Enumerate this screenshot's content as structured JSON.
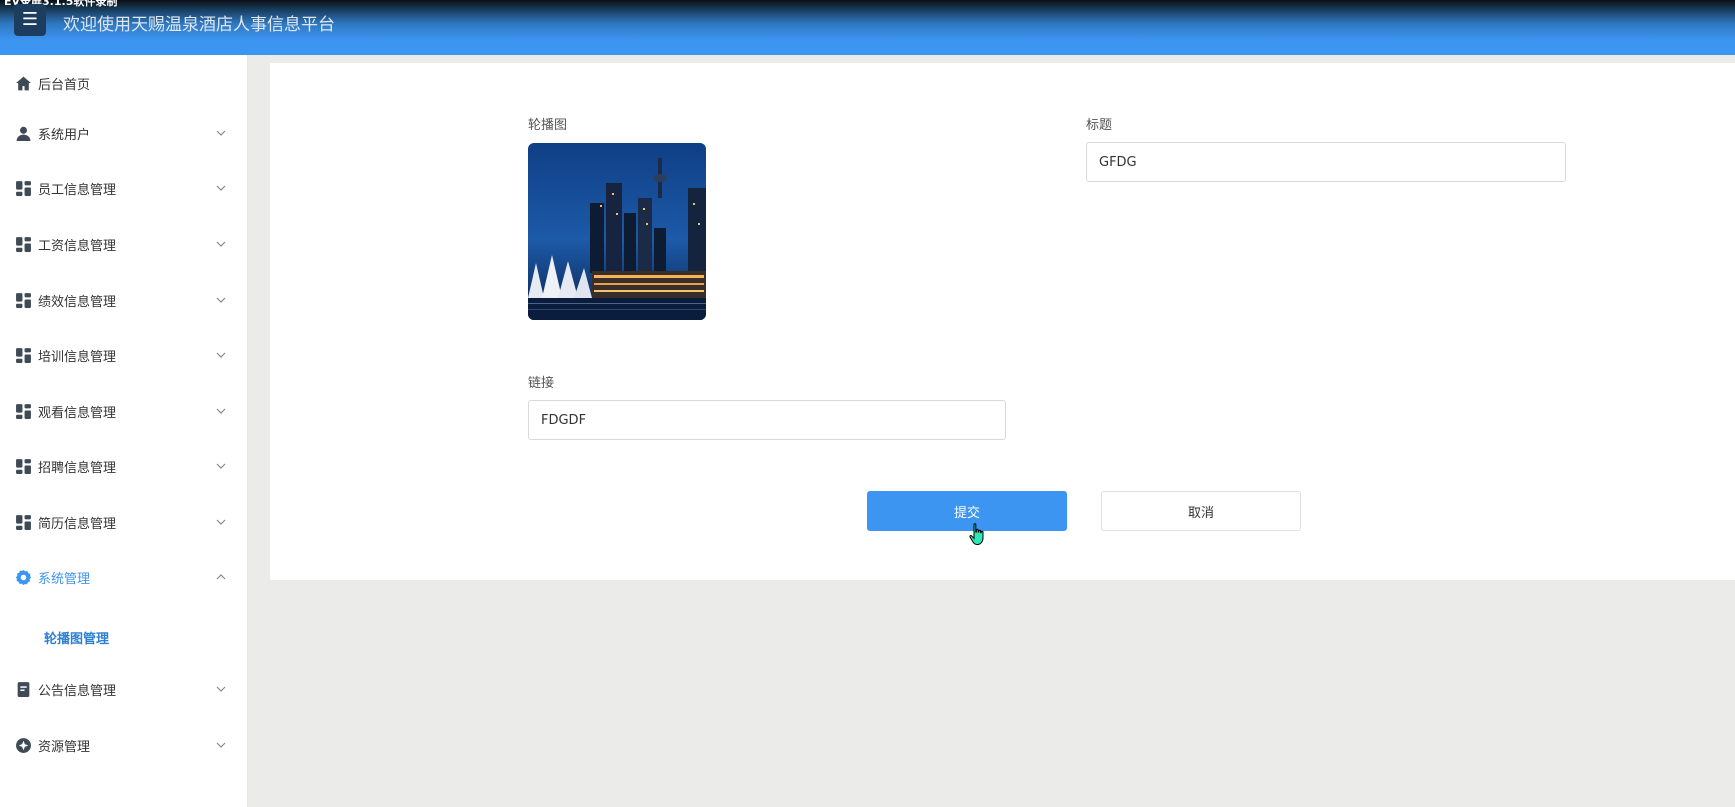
{
  "header": {
    "watermark": "EV录屏3.1.5软件录制",
    "menu_icon": "hamburger-icon",
    "title": "欢迎使用天赐温泉酒店人事信息平台"
  },
  "sidebar": {
    "items": [
      {
        "label": "后台首页",
        "icon": "home-icon"
      },
      {
        "label": "系统用户",
        "icon": "user-icon"
      },
      {
        "label": "员工信息管理",
        "icon": "grid-icon"
      },
      {
        "label": "工资信息管理",
        "icon": "grid-icon"
      },
      {
        "label": "绩效信息管理",
        "icon": "grid-icon"
      },
      {
        "label": "培训信息管理",
        "icon": "grid-icon"
      },
      {
        "label": "观看信息管理",
        "icon": "grid-icon"
      },
      {
        "label": "招聘信息管理",
        "icon": "grid-icon"
      },
      {
        "label": "简历信息管理",
        "icon": "grid-icon"
      },
      {
        "label": "系统管理",
        "icon": "settings-icon"
      },
      {
        "label": "公告信息管理",
        "icon": "notice-icon"
      },
      {
        "label": "资源管理",
        "icon": "resource-icon"
      }
    ],
    "sub_item": "轮播图管理"
  },
  "form": {
    "carousel_label": "轮播图",
    "title_label": "标题",
    "title_value": "GFDG",
    "link_label": "链接",
    "link_value": "FDGDF",
    "submit_label": "提交",
    "cancel_label": "取消"
  },
  "colors": {
    "primary": "#3d95f2",
    "header_dark": "#0a0f16",
    "sidebar_icon": "#3f4a57",
    "active_text": "#3d95f2",
    "page_bg": "#ebebe9"
  }
}
